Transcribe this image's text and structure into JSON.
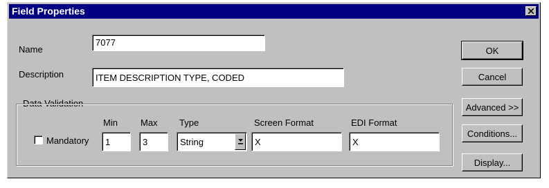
{
  "window": {
    "title": "Field Properties",
    "close_glyph": "✕"
  },
  "name": {
    "label": "Name",
    "value": "7077"
  },
  "description": {
    "label": "Description",
    "value": "ITEM DESCRIPTION TYPE, CODED"
  },
  "data_validation": {
    "title": "Data Validation",
    "mandatory": {
      "label": "Mandatory",
      "checked": false
    },
    "min": {
      "label": "Min",
      "value": "1"
    },
    "max": {
      "label": "Max",
      "value": "3"
    },
    "type": {
      "label": "Type",
      "value": "String"
    },
    "screen_format": {
      "label": "Screen Format",
      "value": "X"
    },
    "edi_format": {
      "label": "EDI Format",
      "value": "X"
    }
  },
  "buttons": {
    "ok": "OK",
    "cancel": "Cancel",
    "advanced": "Advanced >>",
    "conditions": "Conditions...",
    "display": "Display..."
  },
  "icons": {
    "close": "close-icon",
    "dropdown": "dropdown-arrow-icon"
  }
}
